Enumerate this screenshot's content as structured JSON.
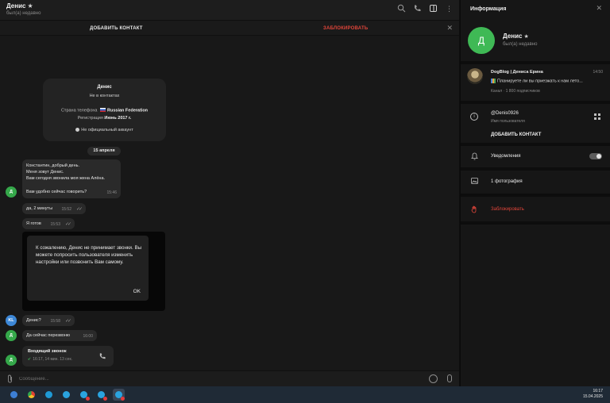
{
  "chat": {
    "name": "Денис",
    "status": "был(а) недавно",
    "actions": {
      "add_contact": "ДОБАВИТЬ КОНТАКТ",
      "block": "ЗАБЛОКИРОВАТЬ"
    },
    "info_card": {
      "name": "Денис",
      "subtitle": "Не в контактах",
      "phone_country_label": "Страна телефона",
      "phone_country_value": "Russian Federation",
      "registration_label": "Регистрация",
      "registration_value": "Июнь 2017 г.",
      "official": "Не официальный аккаунт"
    },
    "date_separator": "15 апреля",
    "messages": [
      {
        "lines": [
          "Константин, добрый день.",
          "Меня зовут Денис.",
          "Вам сегодня звонила моя жена Алёна.",
          "Вам удобно сейчас говорить?"
        ],
        "time": "15:46",
        "incoming": true,
        "avatar": "Д"
      },
      {
        "text": "да, 2 минуты",
        "time": "15:52",
        "incoming": false
      },
      {
        "text": "Я готов",
        "time": "15:53",
        "incoming": false
      },
      {
        "text": "Денис?",
        "time": "15:58",
        "incoming": false,
        "avatar": "KL"
      },
      {
        "text": "Да сейчас перезвоню",
        "time": "16:00",
        "incoming": true,
        "avatar": "Д"
      }
    ],
    "call": {
      "title": "Входящий звонок",
      "details": "16:17, 14 мин. 13 сек.",
      "avatar": "Д"
    },
    "dialog": {
      "text": "К сожалению, Денис не принимает звонки. Вы можете попросить пользователя изменить настройки или позвонить Вам самому.",
      "ok": "OK"
    },
    "composer_placeholder": "Сообщение..."
  },
  "panel": {
    "title": "Информация",
    "avatar_letter": "Д",
    "name": "Денис",
    "status": "был(а) недавно",
    "channel": {
      "name": "DogBlog | Дениса Ерина",
      "time": "14:50",
      "message": "Планируете ли вы приезжать к нам лето...",
      "meta": "Канал · 1 800 подписчиков"
    },
    "username": "@Denis0926",
    "username_label": "Имя пользователя",
    "add_contact": "ДОБАВИТЬ КОНТАКТ",
    "notifications": "Уведомления",
    "notifications_on": true,
    "photos": "1 фотография",
    "block": "Заблокировать"
  },
  "taskbar": {
    "time": "16:17",
    "date": "15.04.2025"
  },
  "colors": {
    "accent_green": "#3fb955",
    "danger_red": "#e0453a",
    "avatar_blue": "#3d87d6"
  }
}
